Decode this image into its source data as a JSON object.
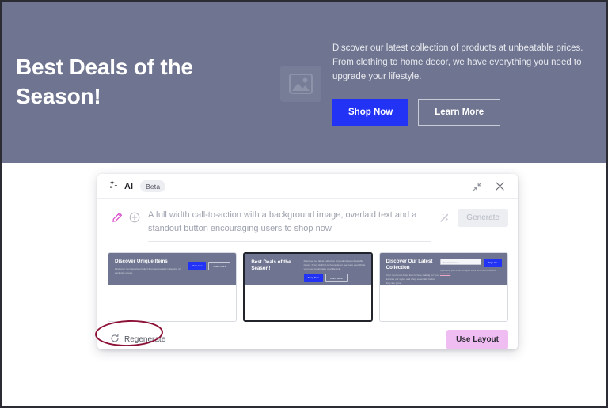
{
  "hero": {
    "title": "Best Deals of the Season!",
    "image_placeholder_icon": "image-placeholder-icon",
    "description": "Discover our latest collection of products at unbeatable prices. From clothing to home decor, we have everything you need to upgrade your lifestyle.",
    "primary_button": "Shop Now",
    "secondary_button": "Learn More",
    "background_color": "#6f7590",
    "primary_button_color": "#2333f5"
  },
  "panel": {
    "header": {
      "sparkle_icon": "ai-sparkle-icon",
      "title": "AI",
      "badge": "Beta",
      "collapse_icon": "collapse-diagonal-icon",
      "close_icon": "close-icon"
    },
    "prompt": {
      "pencil_icon": "pencil-icon",
      "add_icon": "plus-circle-icon",
      "text": "A full width call-to-action with a background image, overlaid text and a standout button encouraging users to shop now",
      "wand_icon": "magic-wand-icon",
      "generate_button": "Generate",
      "generate_disabled": true
    },
    "cards": [
      {
        "name": "discover-unique-items",
        "title": "Discover Unique Items",
        "subtitle": "Find your next favorite product from our curated collection of exclusive goods.",
        "primary_button": "Shop now",
        "secondary_button": "Learn more",
        "selected": false,
        "variant": "buttons"
      },
      {
        "name": "best-deals-of-the-season",
        "title": "Best Deals of the Season!",
        "description": "Discover our latest collection of products at unbeatable prices. From clothing to home decor, we have everything you need to upgrade your lifestyle.",
        "primary_button": "Shop Now",
        "secondary_button": "Learn More",
        "selected": true,
        "variant": "description"
      },
      {
        "name": "discover-our-latest-collection",
        "title": "Discover Our Latest Collection",
        "subtitle": "Your next must-have item is here waiting for you. Explore our styles and shop essentials before they are gone.",
        "input_placeholder": "Email address",
        "signup_button": "Sign Up",
        "fine_print": "By entering your email you agree to our terms and conditions.",
        "fine_print_link": "Learn more",
        "selected": false,
        "variant": "signup"
      }
    ],
    "footer": {
      "regenerate_icon": "refresh-icon",
      "regenerate_label": "Regenerate",
      "use_layout_button": "Use Layout",
      "use_layout_color": "#f0bdf2"
    }
  },
  "annotation": {
    "shape": "ellipse",
    "color": "#8c1036",
    "targets": "Regenerate"
  }
}
